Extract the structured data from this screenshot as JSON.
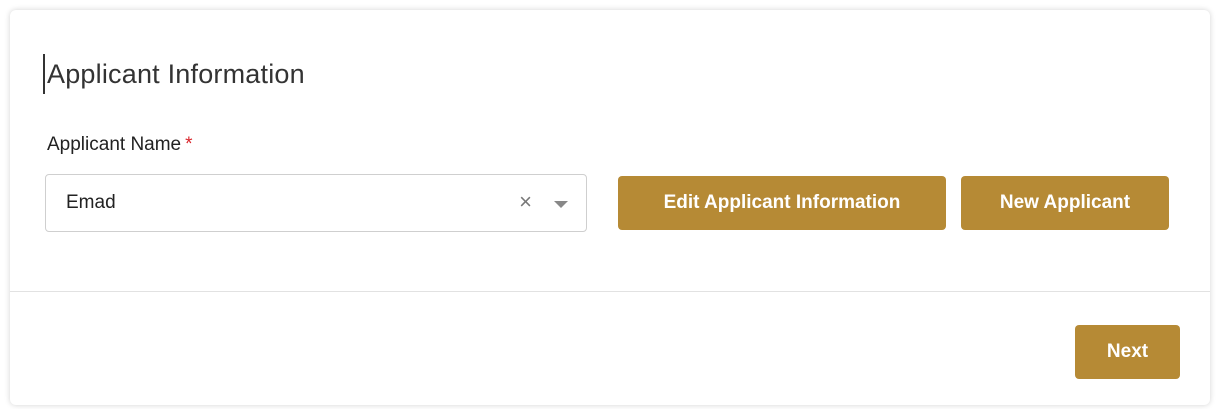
{
  "section": {
    "title": "Applicant Information"
  },
  "applicant_field": {
    "label": "Applicant Name",
    "required_marker": "*",
    "selected_value": "Emad",
    "clear_glyph": "×",
    "icons": [
      "clear-icon",
      "chevron-down-icon"
    ]
  },
  "actions": {
    "edit_label": "Edit Applicant Information",
    "new_label": "New Applicant"
  },
  "footer": {
    "next_label": "Next"
  },
  "colors": {
    "accent": "#b68a35",
    "required": "#d9262c"
  }
}
